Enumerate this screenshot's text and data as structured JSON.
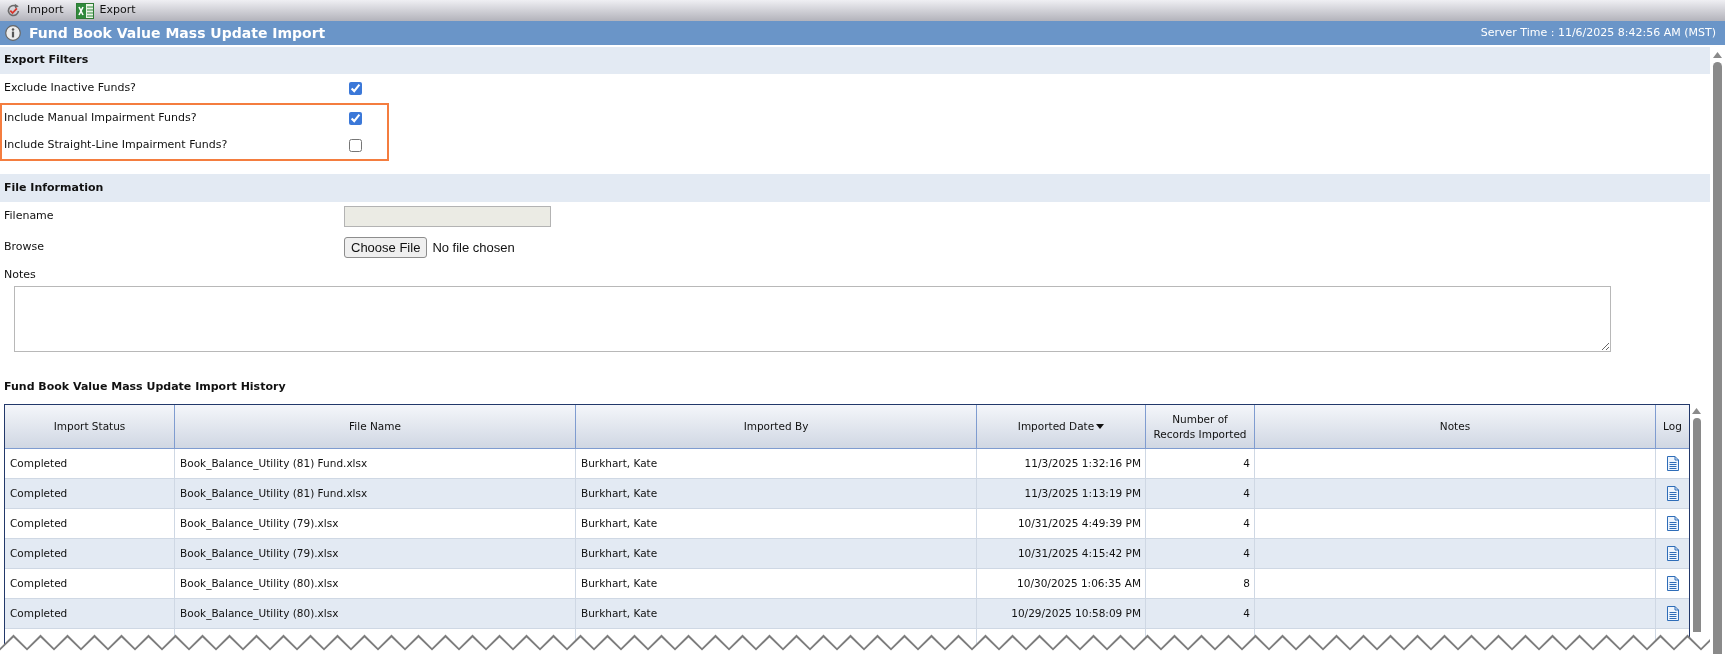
{
  "toolbar": {
    "buttons": [
      {
        "kind": "import",
        "label": "Import"
      },
      {
        "kind": "export",
        "label": "Export"
      }
    ]
  },
  "title_bar": {
    "title": "Fund Book Value Mass Update Import",
    "server_time": "Server Time : 11/6/2025 8:42:56 AM (MST)"
  },
  "export_filters": {
    "title": "Export Filters",
    "items": [
      {
        "label": "Exclude Inactive Funds?",
        "checked": true,
        "highlighted": false
      },
      {
        "label": "Include Manual Impairment Funds?",
        "checked": true,
        "highlighted": true
      },
      {
        "label": "Include Straight-Line Impairment Funds?",
        "checked": false,
        "highlighted": true
      }
    ]
  },
  "file_information": {
    "title": "File Information",
    "filename": {
      "label": "Filename",
      "disabled": true
    },
    "browse": {
      "label": "Browse",
      "button": "Choose File",
      "status": "No file chosen"
    },
    "notes": {
      "label": "Notes"
    }
  },
  "history": {
    "title": "Fund Book Value Mass Update Import History",
    "columns": [
      {
        "label": "Import Status",
        "kind": "status",
        "sorted": false
      },
      {
        "label": "File Name",
        "kind": "file_name",
        "sorted": false
      },
      {
        "label": "Imported By",
        "kind": "imported_by",
        "sorted": false
      },
      {
        "label": "Imported Date",
        "kind": "imported_date",
        "sorted": true
      },
      {
        "label": "Number of Records Imported",
        "kind": "records",
        "sorted": false
      },
      {
        "label": "Notes",
        "kind": "notes",
        "sorted": false
      },
      {
        "label": "Log",
        "kind": "log",
        "sorted": false
      }
    ],
    "rows": [
      {
        "status": "Completed",
        "file_name": "Book_Balance_Utility (81) Fund.xlsx",
        "imported_by": "Burkhart, Kate",
        "imported_date": "11/3/2025 1:32:16 PM",
        "records": "4",
        "log": true
      },
      {
        "status": "Completed",
        "file_name": "Book_Balance_Utility (81) Fund.xlsx",
        "imported_by": "Burkhart, Kate",
        "imported_date": "11/3/2025 1:13:19 PM",
        "records": "4",
        "log": true
      },
      {
        "status": "Completed",
        "file_name": "Book_Balance_Utility (79).xlsx",
        "imported_by": "Burkhart, Kate",
        "imported_date": "10/31/2025 4:49:39 PM",
        "records": "4",
        "log": true
      },
      {
        "status": "Completed",
        "file_name": "Book_Balance_Utility (79).xlsx",
        "imported_by": "Burkhart, Kate",
        "imported_date": "10/31/2025 4:15:42 PM",
        "records": "4",
        "log": true
      },
      {
        "status": "Completed",
        "file_name": "Book_Balance_Utility (80).xlsx",
        "imported_by": "Burkhart, Kate",
        "imported_date": "10/30/2025 1:06:35 AM",
        "records": "8",
        "log": true
      },
      {
        "status": "Completed",
        "file_name": "Book_Balance_Utility (80).xlsx",
        "imported_by": "Burkhart, Kate",
        "imported_date": "10/29/2025 10:58:09 PM",
        "records": "4",
        "log": true
      }
    ]
  }
}
